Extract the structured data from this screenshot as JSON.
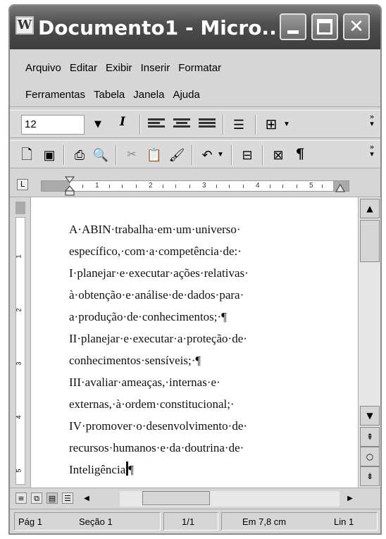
{
  "window": {
    "title": "Documento1 - Micro..."
  },
  "menu": {
    "items": [
      "Arquivo",
      "Editar",
      "Exibir",
      "Inserir",
      "Formatar",
      "Ferramentas",
      "Tabela",
      "Janela",
      "Ajuda"
    ]
  },
  "format_toolbar": {
    "font_size": "12",
    "italic_label": "I"
  },
  "document": {
    "lines": [
      "A·ABIN·trabalha·em·um·universo·",
      "específico,·com·a·competência·de:·",
      "I·planejar·e·executar·ações·relativas·",
      "à·obtenção·e·análise·de·dados·para·",
      "a·produção·de·conhecimentos;·¶",
      "II·planejar·e·executar·a·proteção·de·",
      "conhecimentos·sensíveis;·¶",
      "III·avaliar·ameaças,·internas·e·",
      "externas,·à·ordem·constitucional;·",
      "IV·promover·o·desenvolvimento·de·",
      "recursos·humanos·e·da·doutrina·de·"
    ],
    "last_line_text": "Inteligência",
    "last_line_mark": "¶"
  },
  "ruler": {
    "labels": [
      "1",
      "2",
      "3",
      "4",
      "5"
    ]
  },
  "status": {
    "page": "Pág 1",
    "section": "Seção 1",
    "pages": "1/1",
    "position": "Em 7,8 cm",
    "line": "Lin 1"
  },
  "icons": {
    "title": "document-icon",
    "minimize": "minimize-icon",
    "maximize": "maximize-icon",
    "close": "close-icon"
  }
}
